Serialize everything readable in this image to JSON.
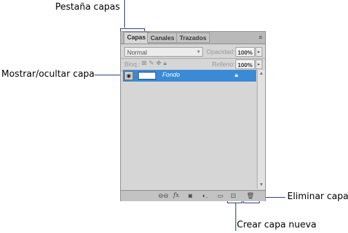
{
  "callouts": {
    "tab": "Pestaña capas",
    "visibility": "Mostrar/ocultar capa",
    "delete": "Eliminar capa",
    "new": "Crear capa nueva"
  },
  "panel": {
    "tabs": [
      "Capas",
      "Canales",
      "Trazados"
    ],
    "menu_icon": "≡",
    "blend_mode": "Normal",
    "opacity_label": "Opacidad:",
    "opacity_value": "100%",
    "lock_label": "Bloq.:",
    "fill_label": "Relleno:",
    "fill_value": "100%",
    "layers": [
      {
        "name": "Fondo",
        "visible": true,
        "locked": true
      }
    ],
    "bottom_icons": [
      "link-icon",
      "fx-icon",
      "mask-icon",
      "adjustment-icon",
      "group-icon",
      "new-layer-icon",
      "trash-icon"
    ]
  }
}
